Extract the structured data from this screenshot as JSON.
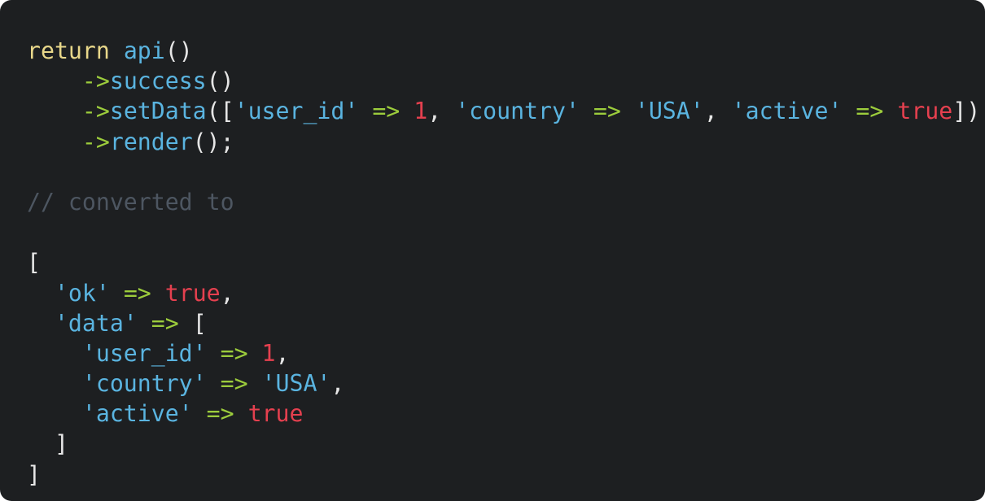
{
  "code": {
    "lines": [
      [
        {
          "t": "return",
          "k": "kw"
        },
        {
          "t": " ",
          "k": "punc"
        },
        {
          "t": "api",
          "k": "fn"
        },
        {
          "t": "()",
          "k": "punc"
        }
      ],
      [
        {
          "t": "    ",
          "k": "punc"
        },
        {
          "t": "->",
          "k": "arrow"
        },
        {
          "t": "success",
          "k": "fn"
        },
        {
          "t": "()",
          "k": "punc"
        }
      ],
      [
        {
          "t": "    ",
          "k": "punc"
        },
        {
          "t": "->",
          "k": "arrow"
        },
        {
          "t": "setData",
          "k": "fn"
        },
        {
          "t": "([",
          "k": "punc"
        },
        {
          "t": "'user_id'",
          "k": "str"
        },
        {
          "t": " ",
          "k": "punc"
        },
        {
          "t": "=>",
          "k": "arrow"
        },
        {
          "t": " ",
          "k": "punc"
        },
        {
          "t": "1",
          "k": "num"
        },
        {
          "t": ", ",
          "k": "punc"
        },
        {
          "t": "'country'",
          "k": "str"
        },
        {
          "t": " ",
          "k": "punc"
        },
        {
          "t": "=>",
          "k": "arrow"
        },
        {
          "t": " ",
          "k": "punc"
        },
        {
          "t": "'USA'",
          "k": "str"
        },
        {
          "t": ", ",
          "k": "punc"
        },
        {
          "t": "'active'",
          "k": "str"
        },
        {
          "t": " ",
          "k": "punc"
        },
        {
          "t": "=>",
          "k": "arrow"
        },
        {
          "t": " ",
          "k": "punc"
        },
        {
          "t": "true",
          "k": "bool"
        },
        {
          "t": "])",
          "k": "punc"
        }
      ],
      [
        {
          "t": "    ",
          "k": "punc"
        },
        {
          "t": "->",
          "k": "arrow"
        },
        {
          "t": "render",
          "k": "fn"
        },
        {
          "t": "();",
          "k": "punc"
        }
      ],
      [],
      [
        {
          "t": "// converted to",
          "k": "cmt"
        }
      ],
      [],
      [
        {
          "t": "[",
          "k": "punc"
        }
      ],
      [
        {
          "t": "  ",
          "k": "punc"
        },
        {
          "t": "'ok'",
          "k": "str"
        },
        {
          "t": " ",
          "k": "punc"
        },
        {
          "t": "=>",
          "k": "arrow"
        },
        {
          "t": " ",
          "k": "punc"
        },
        {
          "t": "true",
          "k": "bool"
        },
        {
          "t": ",",
          "k": "punc"
        }
      ],
      [
        {
          "t": "  ",
          "k": "punc"
        },
        {
          "t": "'data'",
          "k": "str"
        },
        {
          "t": " ",
          "k": "punc"
        },
        {
          "t": "=>",
          "k": "arrow"
        },
        {
          "t": " [",
          "k": "punc"
        }
      ],
      [
        {
          "t": "    ",
          "k": "punc"
        },
        {
          "t": "'user_id'",
          "k": "str"
        },
        {
          "t": " ",
          "k": "punc"
        },
        {
          "t": "=>",
          "k": "arrow"
        },
        {
          "t": " ",
          "k": "punc"
        },
        {
          "t": "1",
          "k": "num"
        },
        {
          "t": ",",
          "k": "punc"
        }
      ],
      [
        {
          "t": "    ",
          "k": "punc"
        },
        {
          "t": "'country'",
          "k": "str"
        },
        {
          "t": " ",
          "k": "punc"
        },
        {
          "t": "=>",
          "k": "arrow"
        },
        {
          "t": " ",
          "k": "punc"
        },
        {
          "t": "'USA'",
          "k": "str"
        },
        {
          "t": ",",
          "k": "punc"
        }
      ],
      [
        {
          "t": "    ",
          "k": "punc"
        },
        {
          "t": "'active'",
          "k": "str"
        },
        {
          "t": " ",
          "k": "punc"
        },
        {
          "t": "=>",
          "k": "arrow"
        },
        {
          "t": " ",
          "k": "punc"
        },
        {
          "t": "true",
          "k": "bool"
        }
      ],
      [
        {
          "t": "  ]",
          "k": "punc"
        }
      ],
      [
        {
          "t": "]",
          "k": "punc"
        }
      ]
    ]
  },
  "theme": {
    "background": "#1d1f21",
    "keyword": "#e8d78a",
    "function": "#5ab4e0",
    "arrow": "#9ccc3c",
    "string": "#5ab4e0",
    "number": "#e5404f",
    "boolean": "#e5404f",
    "punctuation": "#e6e6e6",
    "comment": "#4d5661"
  }
}
